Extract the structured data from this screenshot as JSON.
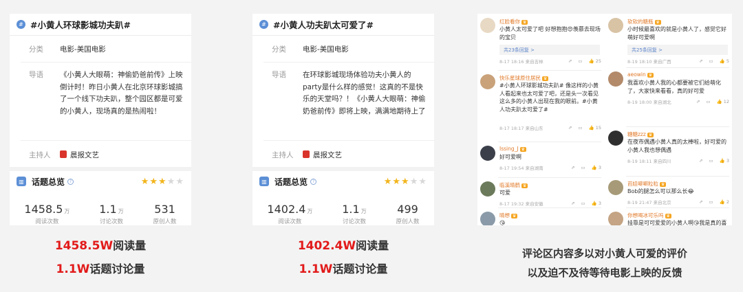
{
  "cards": [
    {
      "title": "#小黄人环球影城功夫趴#",
      "category_label": "分类",
      "category_value": "电影-美国电影",
      "guide_label": "导语",
      "guide_value": "《小黄人大眼萌：神偷奶爸前传》上映倒计时！昨日小黄人在北京环球影城搞了一个线下功夫趴，整个园区都是可爱的小黄人，现场真的是热闹啦！",
      "host_label": "主持人",
      "host_value": "晨报文艺",
      "overview_title": "话题总览",
      "rating": 2.5,
      "stats": [
        {
          "num": "1458.5",
          "unit": "万",
          "label": "阅读次数"
        },
        {
          "num": "1.1",
          "unit": "万",
          "label": "讨论次数"
        },
        {
          "num": "531",
          "unit": "",
          "label": "原创人数"
        }
      ],
      "caption_big_1": "1458.5W",
      "caption_rest_1": "阅读量",
      "caption_big_2": "1.1W",
      "caption_rest_2": "话题讨论量"
    },
    {
      "title": "#小黄人功夫趴太可爱了#",
      "category_label": "分类",
      "category_value": "电影-美国电影",
      "guide_label": "导语",
      "guide_value": "在环球影城现场体验功夫小黄人的party是什么样的感觉！这真的不是快乐的天堂吗？！《小黄人大眼萌：神偷奶爸前传》即将上映，满满地期待上了",
      "host_label": "主持人",
      "host_value": "晨报文艺",
      "overview_title": "话题总览",
      "rating": 2.5,
      "stats": [
        {
          "num": "1402.4",
          "unit": "万",
          "label": "阅读次数"
        },
        {
          "num": "1.1",
          "unit": "万",
          "label": "讨论次数"
        },
        {
          "num": "499",
          "unit": "",
          "label": "原创人数"
        }
      ],
      "caption_big_1": "1402.4W",
      "caption_rest_1": "阅读量",
      "caption_big_2": "1.1W",
      "caption_rest_2": "话题讨论量"
    }
  ],
  "comments_left": [
    {
      "name": "红脸看你",
      "text": "小黄人太可爱了吧 好想抱抱😍羡慕去现场的宝贝",
      "reply": "共23条回复 >",
      "meta": "8-17 18:16 来自吉林",
      "likes": "25",
      "avatar_color": "#e8d9c4"
    },
    {
      "name": "快乐星球原住居民",
      "text": "#小黄人环球影城功夫趴# 像这样的小黄人看起来也太可爱了吧，还是头一次看见这么多的小黄人出现在我的眼前。#小黄人功夫趴太可爱了#",
      "reply": "",
      "meta": "8-17 18:17 来自山东",
      "likes": "15",
      "avatar_color": "#c9a27a"
    },
    {
      "name": "Issing_J",
      "text": "好可爱啊",
      "reply": "",
      "meta": "8-17 19:54 来自湖南",
      "likes": "3",
      "avatar_color": "#3a3f4a"
    },
    {
      "name": "临溪晴鹤",
      "text": "可爱",
      "reply": "",
      "meta": "8-17 19:32 来自安徽",
      "likes": "3",
      "avatar_color": "#6b7a5a"
    },
    {
      "name": "晴想",
      "text": "😘",
      "reply": "",
      "meta": "",
      "likes": "",
      "avatar_color": "#8a9aa8"
    }
  ],
  "comments_right": [
    {
      "name": "软软的糖瓶",
      "text": "小时候最喜欢的就是小黄人了，感觉它好萌好可爱啊",
      "reply": "共25条回复 >",
      "meta": "8-19 18:10 来自广西",
      "likes": "5",
      "avatar_color": "#d8c3a5"
    },
    {
      "name": "aeowin",
      "text": "我喜欢小黄人我的心都要被它们给萌化了，大家快来看看，真的好可爱",
      "reply": "",
      "meta": "8-19 18:00 来自湖北",
      "likes": "12",
      "avatar_color": "#b38a6a"
    },
    {
      "name": "糖糖zzz",
      "text": "在夜市偶遇小黄人真的太棒啦，好可爱的小黄人我也想偶遇",
      "reply": "",
      "meta": "8-19 18:11 来自四川",
      "likes": "3",
      "avatar_color": "#2f2f2f"
    },
    {
      "name": "芭娃噼噼粒粒",
      "text": "Bob的腿怎么可以那么长😂",
      "reply": "",
      "meta": "8-19 21:47 来自北京",
      "likes": "2",
      "avatar_color": "#a79a78"
    },
    {
      "name": "你想喝冰可乐吗",
      "text": "挂靠是可可爱爱的小黄人啊😘我是真的喜欢",
      "reply": "",
      "meta": "",
      "likes": "",
      "avatar_color": "#c4a484"
    }
  ],
  "comments_caption_1": "评论区内容多以对小黄人可爱的评价",
  "comments_caption_2": "以及迫不及待等待电影上映的反馈"
}
